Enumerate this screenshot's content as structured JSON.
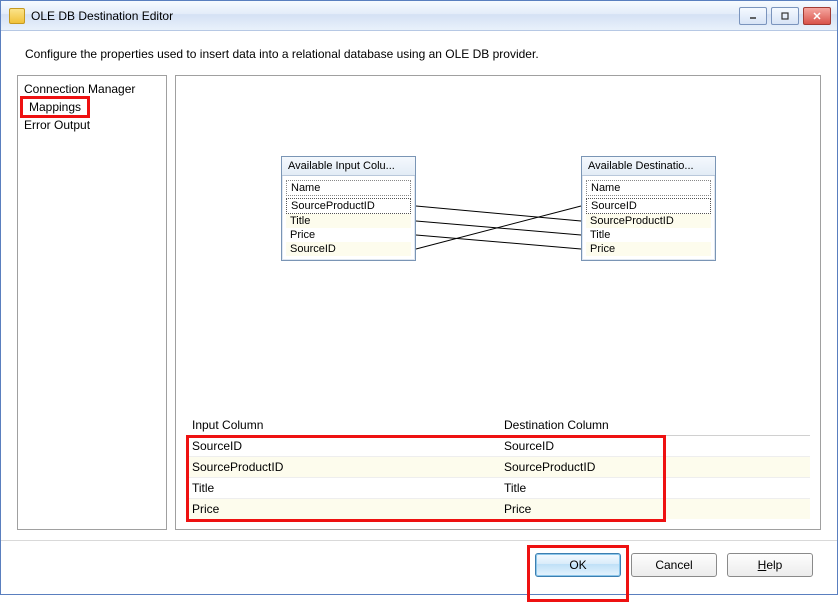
{
  "window": {
    "title": "OLE DB Destination Editor"
  },
  "description": "Configure the properties used to insert data into a relational database using an OLE DB provider.",
  "sidebar": {
    "items": [
      {
        "label": "Connection Manager",
        "highlighted": false
      },
      {
        "label": "Mappings",
        "highlighted": true
      },
      {
        "label": "Error Output",
        "highlighted": false
      }
    ]
  },
  "diagram": {
    "input_box": {
      "title": "Available Input Colu...",
      "header": "Name",
      "items": [
        "SourceProductID",
        "Title",
        "Price",
        "SourceID"
      ]
    },
    "dest_box": {
      "title": "Available Destinatio...",
      "header": "Name",
      "items": [
        "SourceID",
        "SourceProductID",
        "Title",
        "Price"
      ]
    },
    "connections": [
      {
        "from_index": 0,
        "to_index": 1
      },
      {
        "from_index": 1,
        "to_index": 2
      },
      {
        "from_index": 2,
        "to_index": 3
      },
      {
        "from_index": 3,
        "to_index": 0
      }
    ]
  },
  "mapping_table": {
    "headers": {
      "input": "Input Column",
      "dest": "Destination Column"
    },
    "rows": [
      {
        "input": "SourceID",
        "dest": "SourceID"
      },
      {
        "input": "SourceProductID",
        "dest": "SourceProductID"
      },
      {
        "input": "Title",
        "dest": "Title"
      },
      {
        "input": "Price",
        "dest": "Price"
      }
    ]
  },
  "buttons": {
    "ok": "OK",
    "cancel": "Cancel",
    "help": "Help"
  }
}
